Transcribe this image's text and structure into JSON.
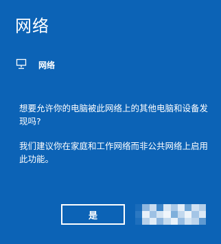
{
  "dialog": {
    "title": "网络",
    "network_name": "网络",
    "network_icon": "network-computer-icon",
    "question": "想要允许你的电脑被此网络上的其他电脑和设备发现吗?",
    "recommendation": "我们建议你在家庭和工作网络而非公共网络上启用此功能。",
    "yes_label": "是",
    "no_label": ""
  },
  "colors": {
    "background": "#0c63b6",
    "text": "#ffffff"
  }
}
